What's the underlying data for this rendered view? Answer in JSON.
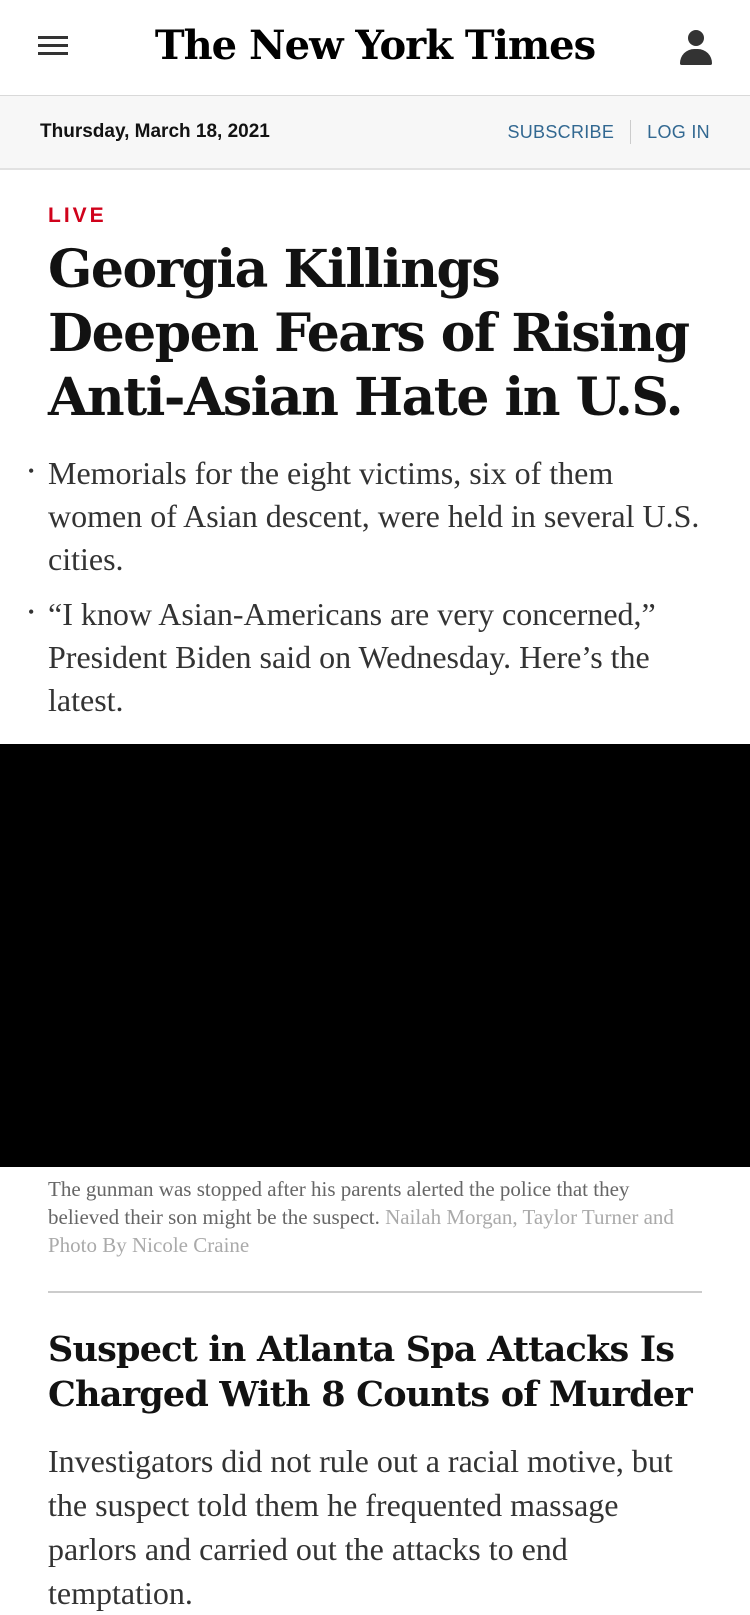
{
  "header": {
    "logo_text": "The New York Times",
    "menu_icon": "hamburger-menu-icon",
    "account_icon": "user-account-icon"
  },
  "datebar": {
    "date": "Thursday, March 18, 2021",
    "subscribe_label": "SUBSCRIBE",
    "login_label": "LOG IN"
  },
  "lead_story": {
    "kicker": "LIVE",
    "headline": "Georgia Killings Deepen Fears of Rising Anti-Asian Hate in U.S.",
    "bullets": [
      "Memorials for the eight victims, six of them women of Asian descent, were held in several U.S. cities.",
      "“I know Asian-Americans are very concerned,” President Biden said on Wednesday. Here’s the latest."
    ],
    "caption": "The gunman was stopped after his parents alerted the police that they believed their son might be the suspect.",
    "credit": "Nailah Morgan, Taylor Turner and Photo By Nicole Craine"
  },
  "second_story": {
    "headline": "Suspect in Atlanta Spa Attacks Is Charged With 8 Counts of Murder",
    "summary": "Investigators did not rule out a racial motive, but the suspect told them he frequented massage parlors and carried out the attacks to end temptation."
  },
  "colors": {
    "kicker_red": "#d0021b",
    "link_blue": "#326891",
    "datebar_bg": "#f7f7f7"
  }
}
